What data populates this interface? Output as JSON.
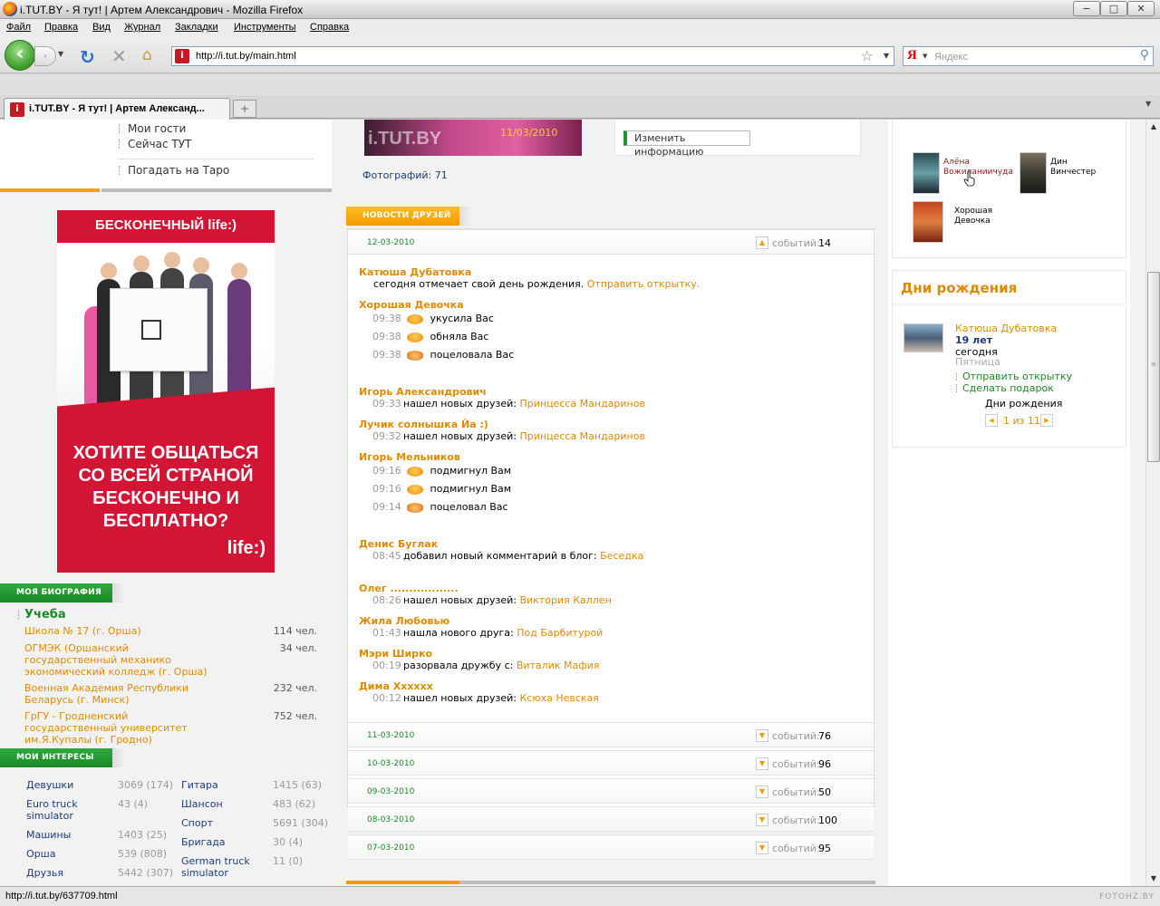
{
  "window": {
    "title": "i.TUT.BY - Я тут! | Артем Александрович - Mozilla Firefox",
    "minimize": "−",
    "maximize": "□",
    "close": "✕"
  },
  "menu": [
    "Файл",
    "Правка",
    "Вид",
    "Журнал",
    "Закладки",
    "Инструменты",
    "Справка"
  ],
  "nav": {
    "url": "http://i.tut.by/main.html",
    "search_engine": "Я",
    "search_placeholder": "Яндекс"
  },
  "tab": {
    "label": "i.TUT.BY - Я тут! | Артем Александ...",
    "new_tab": "+"
  },
  "status": {
    "text": "http://i.tut.by/637709.html",
    "watermark": "FOTOHZ.BY"
  },
  "left_menu": [
    "Мои гости",
    "Сейчас ТУТ",
    "Погадать на Таро"
  ],
  "ad": {
    "headline": "БЕСКОНЕЧНЫЙ life:)",
    "slogan": "ХОТИТЕ ОБЩАТЬСЯ СО ВСЕЙ СТРАНОЙ БЕСКОНЕЧНО И БЕСПЛАТНО?",
    "brand": "life:)",
    "colors": {
      "red": "#d21435"
    }
  },
  "biography": {
    "tag": "Моя биография",
    "subhead": "Учеба",
    "schools": [
      {
        "name": "Школа № 17 (г. Орша)",
        "count": "114 чел."
      },
      {
        "name": "ОГМЭК (Оршанский государственный механико экономический колледж (г. Орша)",
        "count": "34 чел."
      },
      {
        "name": "Военная Академия Республики Беларусь (г. Минск)",
        "count": "232 чел."
      },
      {
        "name": "ГрГУ - Гродненский государственный университет им.Я.Купалы (г. Гродно)",
        "count": "752 чел."
      }
    ]
  },
  "interests": {
    "tag": "Мои интересы",
    "left": [
      {
        "name": "Девушки",
        "value": "3069 (174)"
      },
      {
        "name": "Euro truck simulator",
        "value": "43 (4)"
      },
      {
        "name": "Машины",
        "value": "1403 (25)"
      },
      {
        "name": "Орша",
        "value": "539 (808)"
      },
      {
        "name": "Друзья",
        "value": "5442 (307)"
      }
    ],
    "right": [
      {
        "name": "Гитара",
        "value": "1415 (63)"
      },
      {
        "name": "Шансон",
        "value": "483 (62)"
      },
      {
        "name": "Спорт",
        "value": "5691 (304)"
      },
      {
        "name": "Бригада",
        "value": "30 (4)"
      },
      {
        "name": "German truck simulator",
        "value": "11 (0)"
      }
    ]
  },
  "photos": {
    "date": "11/03/2010",
    "logo": "i.TUT.BY",
    "count": "Фотографий: 71"
  },
  "info_button": "Изменить информацию",
  "news": {
    "tag": "Новости друзей",
    "events_label": "событий:",
    "current": {
      "date": "12-03-2010",
      "count": "14"
    },
    "feed": [
      {
        "name": "Катюша Дубатовка",
        "lines": [
          {
            "time": "",
            "text": "сегодня отмечает свой день рождения.",
            "link": "Отправить открытку."
          }
        ]
      },
      {
        "name": "Хорошая Девочка",
        "lines": [
          {
            "time": "09:38",
            "icon": "gift-icon",
            "text": "укусила Вас"
          },
          {
            "time": "09:38",
            "icon": "gift-icon",
            "text": "обняла Вас"
          },
          {
            "time": "09:38",
            "icon": "lips-icon",
            "text": "поцеловала Вас"
          }
        ]
      },
      {
        "name": "Игорь Александрович",
        "lines": [
          {
            "time": "09:33",
            "text": "нашел новых друзей:",
            "link": "Принцесса Мандаринов"
          }
        ]
      },
      {
        "name": "Лучик солнышка Йа :)",
        "lines": [
          {
            "time": "09:32",
            "text": "нашел новых друзей:",
            "link": "Принцесса Мандаринов"
          }
        ]
      },
      {
        "name": "Игорь Мельников",
        "lines": [
          {
            "time": "09:16",
            "icon": "wink-icon",
            "text": "подмигнул Вам"
          },
          {
            "time": "09:16",
            "icon": "wink-icon",
            "text": "подмигнул Вам"
          },
          {
            "time": "09:14",
            "icon": "lips-icon",
            "text": "поцеловал Вас"
          }
        ]
      },
      {
        "name": "Денис Буглак",
        "lines": [
          {
            "time": "08:45",
            "text": "добавил новый комментарий в блог:",
            "link": "Беседка"
          }
        ]
      },
      {
        "name": "Олег ..................",
        "lines": [
          {
            "time": "08:26",
            "text": "нашел новых друзей:",
            "link": "Виктория Каллен"
          }
        ]
      },
      {
        "name": "Жила Любовью",
        "lines": [
          {
            "time": "01:43",
            "text": "нашла нового друга:",
            "link": "Под Барбитурой"
          }
        ]
      },
      {
        "name": "Мэри Ширко",
        "lines": [
          {
            "time": "00:19",
            "text": "разорвала дружбу с:",
            "link": "Виталик Мафия"
          }
        ]
      },
      {
        "name": "Дима Хххххх",
        "lines": [
          {
            "time": "00:12",
            "text": "нашел новых друзей:",
            "link": "Ксюха Невская"
          }
        ]
      }
    ],
    "past": [
      {
        "date": "11-03-2010",
        "count": "76"
      },
      {
        "date": "10-03-2010",
        "count": "96"
      },
      {
        "date": "09-03-2010",
        "count": "50"
      },
      {
        "date": "08-03-2010",
        "count": "100"
      },
      {
        "date": "07-03-2010",
        "count": "95"
      }
    ]
  },
  "friends": [
    {
      "name": "Алёна Вожиланиичуда",
      "color": "#8a1a1a"
    },
    {
      "name": "Дин Винчестер",
      "color": "#000000"
    },
    {
      "name": "Хорошая Девочка",
      "color": "#000000"
    }
  ],
  "birthdays": {
    "title": "Дни рождения",
    "name": "Катюша Дубатовка",
    "age": "19 лет",
    "when": "сегодня",
    "weekday": "Пятница",
    "actions": [
      "Отправить открытку",
      "Сделать подарок"
    ],
    "label": "Дни рождения",
    "pager": "1 из 11"
  }
}
